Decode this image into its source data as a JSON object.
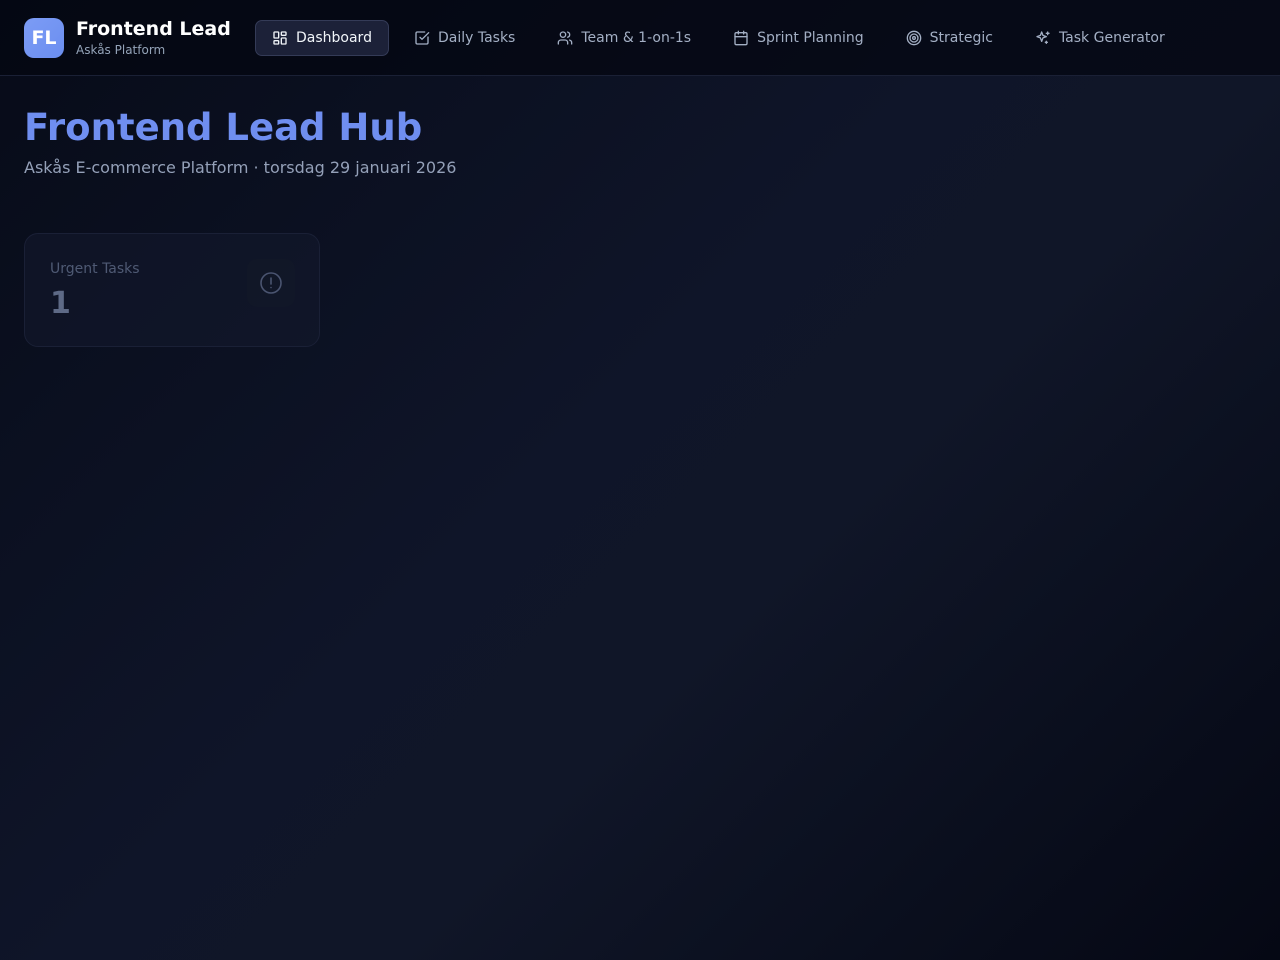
{
  "brand": {
    "logo_text": "FL",
    "title": "Frontend Lead",
    "subtitle": "Askås Platform"
  },
  "nav": {
    "items": [
      {
        "label": "Dashboard",
        "icon": "dashboard-icon",
        "active": true
      },
      {
        "label": "Daily Tasks",
        "icon": "checkbox-icon",
        "active": false
      },
      {
        "label": "Team & 1-on-1s",
        "icon": "users-icon",
        "active": false
      },
      {
        "label": "Sprint Planning",
        "icon": "calendar-icon",
        "active": false
      },
      {
        "label": "Strategic",
        "icon": "target-icon",
        "active": false
      },
      {
        "label": "Task Generator",
        "icon": "sparkles-icon",
        "active": false
      }
    ]
  },
  "header": {
    "title": "Frontend Lead Hub",
    "subtitle": "Askås E-commerce Platform · torsdag 29 januari 2026"
  },
  "stats": [
    {
      "label": "Urgent Tasks",
      "value": "1",
      "icon": "alert-circle-icon"
    }
  ],
  "colors": {
    "accent": "#6f8ef0",
    "logo_bg": "#7c9cf5",
    "background": "#0f1529"
  }
}
